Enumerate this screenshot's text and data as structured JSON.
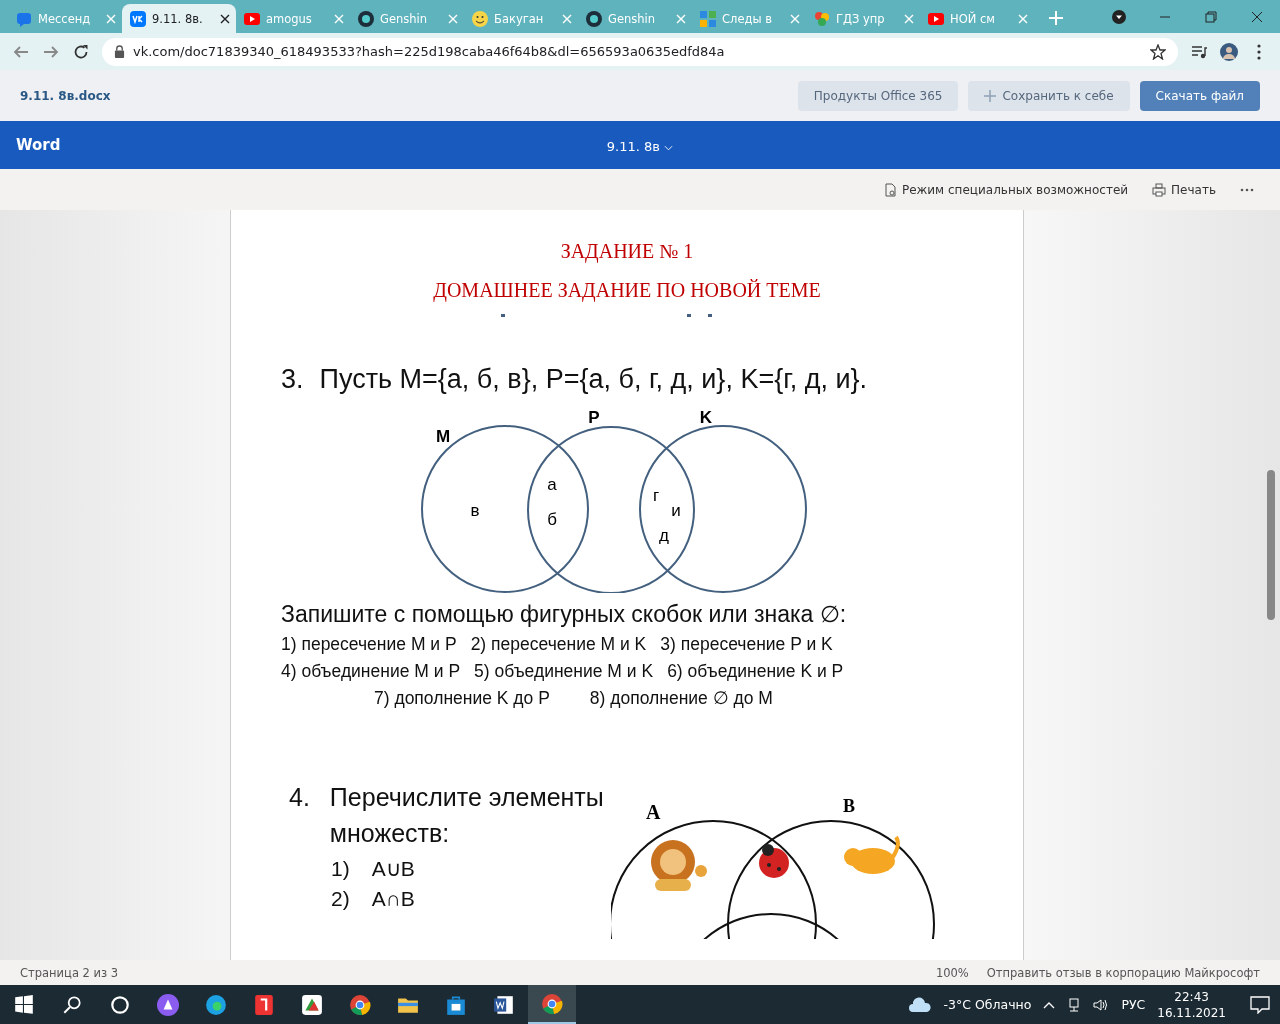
{
  "browser": {
    "tabs": [
      {
        "title": "Мессенд",
        "selected": false
      },
      {
        "title": "9.11. 8в.",
        "selected": true
      },
      {
        "title": "amogus",
        "selected": false
      },
      {
        "title": "Genshin",
        "selected": false
      },
      {
        "title": "Бакуган",
        "selected": false
      },
      {
        "title": "Genshin",
        "selected": false
      },
      {
        "title": "Следы в",
        "selected": false
      },
      {
        "title": "ГДЗ упр",
        "selected": false
      },
      {
        "title": "НОЙ см",
        "selected": false
      }
    ],
    "url": "vk.com/doc71839340_618493533?hash=225d198caba46f64b8&dl=656593a0635edfd84a"
  },
  "vk_header": {
    "file_name": "9.11. 8в.docx",
    "buttons": [
      "Продукты Office 365",
      "Сохранить к себе",
      "Скачать файл"
    ]
  },
  "word_bar": {
    "app": "Word",
    "doc_title": "9.11. 8в"
  },
  "toolbar": {
    "accessibility": "Режим специальных возможностей",
    "print": "Печать"
  },
  "document": {
    "title": "ЗАДАНИЕ № 1",
    "subtitle": "ДОМАШНЕЕ ЗАДАНИЕ ПО НОВОЙ ТЕМЕ",
    "problem3": {
      "number": "3.",
      "statement": "Пусть M={а, б, в}, P={а, б, г, д, и}, K={г, д, и}.",
      "venn": {
        "labels": [
          "M",
          "P",
          "K"
        ],
        "letters": [
          "в",
          "а",
          "б",
          "г",
          "и",
          "д"
        ]
      },
      "instruction": "Запишите с помощью фигурных скобок или знака ∅:",
      "lines": [
        [
          "1) пересечение M и P",
          "2) пересечение M и K",
          "3) пересечение P и K"
        ],
        [
          "4) объединение M и P",
          "5) объединение M и K",
          "6) объединение K и P"
        ],
        [
          "7) дополнение K до P",
          "8)  дополнение ∅ до M"
        ]
      ]
    },
    "problem4": {
      "number": "4.",
      "statement": "Перечислите элементы множеств:",
      "items": [
        {
          "number": "1)",
          "text": "A∪B"
        },
        {
          "number": "2)",
          "text": "A∩B"
        }
      ],
      "venn_labels": [
        "A",
        "B"
      ]
    }
  },
  "status_bar": {
    "page": "Страница 2 из 3",
    "zoom": "100%",
    "feedback": "Отправить отзыв в корпорацию Майкрософт"
  },
  "taskbar": {
    "weather": "-3°C  Облачно",
    "language": "РУС",
    "time": "22:43",
    "date": "16.11.2021"
  }
}
